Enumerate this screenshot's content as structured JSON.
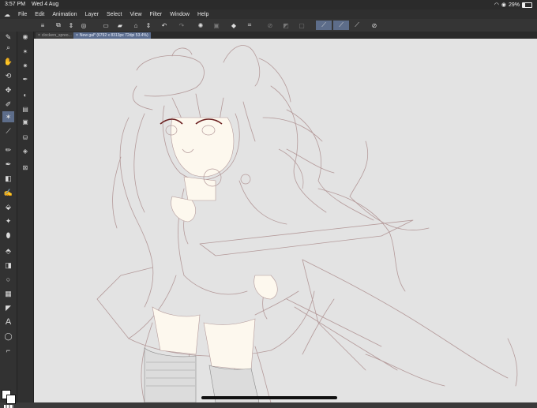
{
  "status_bar": {
    "time": "3:57 PM",
    "date": "Wed 4 Aug",
    "battery_percent": "29%",
    "battery_level": 0.29
  },
  "menu_bar": {
    "app_icon": "clip-studio-icon",
    "items": [
      "File",
      "Edit",
      "Animation",
      "Layer",
      "Select",
      "View",
      "Filter",
      "Window",
      "Help"
    ]
  },
  "command_bar": {
    "icons": [
      "menu-icon",
      "layer-property-icon",
      "up-down-arrows-icon",
      "reference-icon",
      "new-file-icon",
      "open-folder-icon",
      "save-icon",
      "up-down-arrows-icon",
      "undo-icon",
      "redo-icon",
      "rotate-lasso-icon",
      "transform-icon",
      "fill-bucket-icon",
      "crop-icon",
      "clear-icon",
      "fill-icon",
      "invert-icon",
      "stabilizer-icon",
      "snap-icon",
      "ruler-icon",
      "settings-icon"
    ]
  },
  "tools": {
    "icons": [
      "magnifier-icon",
      "hand-icon",
      "rotate-icon",
      "move-icon",
      "pen-icon",
      "magic-wand-icon",
      "eyedropper-icon",
      "pencil-icon",
      "brush-icon",
      "eraser-icon",
      "blend-icon",
      "fill-icon",
      "gradient-icon",
      "shape-icon",
      "frame-icon",
      "ruler-icon",
      "text-icon",
      "balloon-icon",
      "lines-icon"
    ],
    "active": "magic-wand-icon"
  },
  "subtools": {
    "icons": [
      "navigator-icon",
      "wand-icon",
      "wand-2-icon",
      "pen-nib-icon",
      "circle-icon",
      "image-icon",
      "image-2-icon",
      "layers-icon",
      "stack-icon",
      "material-icon"
    ]
  },
  "tabs": [
    {
      "label": "clockers_spreo...",
      "active": false
    },
    {
      "label": "New gal* (6792 x 8313px 72dpi 53.4%)",
      "active": true
    }
  ],
  "colors": {
    "canvas": "#e3e3e3",
    "line_art": "#a07878",
    "skin": "#fdf8ee",
    "active_tool": "#5d6d8a"
  }
}
